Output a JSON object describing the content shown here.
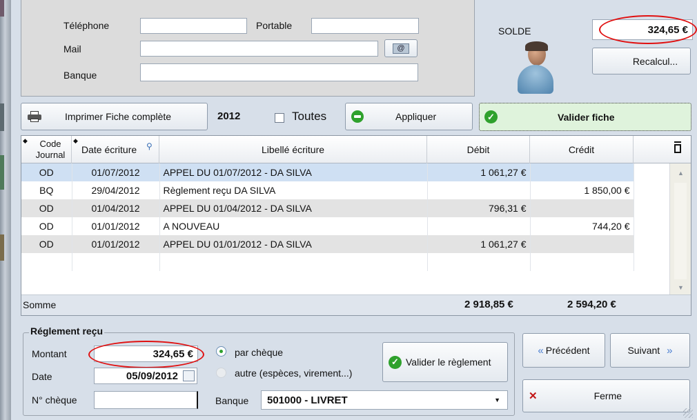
{
  "contact": {
    "telephone_label": "Téléphone",
    "portable_label": "Portable",
    "mail_label": "Mail",
    "banque_label": "Banque",
    "telephone_value": "",
    "portable_value": "",
    "mail_value": "",
    "banque_value": ""
  },
  "solde": {
    "label": "SOLDE",
    "value": "324,65 €",
    "recalcul_label": "Recalcul..."
  },
  "toolbar": {
    "print_label": "Imprimer Fiche complète",
    "year": "2012",
    "toutes_label": "Toutes",
    "appliquer_label": "Appliquer",
    "valider_fiche_label": "Valider fiche"
  },
  "table": {
    "headers": {
      "code": "Code Journal",
      "date": "Date écriture",
      "libelle": "Libellé écriture",
      "debit": "Débit",
      "credit": "Crédit"
    },
    "rows": [
      {
        "code": "OD",
        "date": "01/07/2012",
        "libelle": "APPEL DU 01/07/2012 - DA SILVA",
        "debit": "1 061,27 €",
        "credit": ""
      },
      {
        "code": "BQ",
        "date": "29/04/2012",
        "libelle": "Règlement reçu DA SILVA",
        "debit": "",
        "credit": "1 850,00 €"
      },
      {
        "code": "OD",
        "date": "01/04/2012",
        "libelle": "APPEL DU 01/04/2012 - DA SILVA",
        "debit": "796,31 €",
        "credit": ""
      },
      {
        "code": "OD",
        "date": "01/01/2012",
        "libelle": "A NOUVEAU",
        "debit": "",
        "credit": "744,20 €"
      },
      {
        "code": "OD",
        "date": "01/01/2012",
        "libelle": "APPEL DU 01/01/2012 - DA SILVA",
        "debit": "1 061,27 €",
        "credit": ""
      }
    ],
    "somme_label": "Somme",
    "total_debit": "2 918,85 €",
    "total_credit": "2 594,20 €"
  },
  "reglement": {
    "title": "Réglement reçu",
    "montant_label": "Montant",
    "montant_value": "324,65 €",
    "date_label": "Date",
    "date_value": "05/09/2012",
    "cheque_label": "N° chèque",
    "cheque_value": "",
    "radio_cheque_label": "par chèque",
    "radio_autre_label": "autre (espèces, virement...)",
    "banque_label": "Banque",
    "banque_value": "501000 - LIVRET",
    "valider_label": "Valider le règlement"
  },
  "nav": {
    "precedent_label": "Précédent",
    "suivant_label": "Suivant",
    "ferme_label": "Ferme"
  },
  "colors": {
    "highlight_ellipse": "#e01010",
    "selected_row": "#cfe0f3",
    "valider_fiche_bg": "#dff3dc",
    "check_green": "#2fa12d"
  }
}
